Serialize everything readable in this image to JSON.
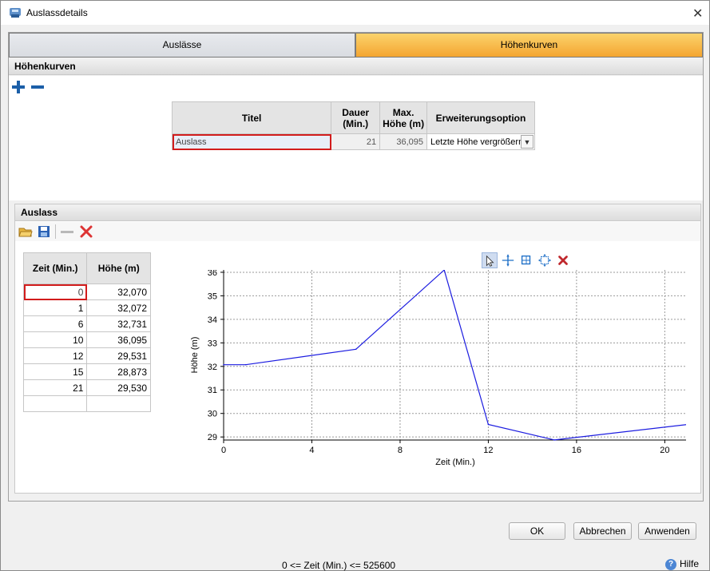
{
  "window": {
    "title": "Auslassdetails",
    "close_glyph": "✕"
  },
  "tabs": [
    {
      "label": "Auslässe"
    },
    {
      "label": "Höhenkurven"
    }
  ],
  "curves_section": {
    "title": "Höhenkurven",
    "columns": [
      "Titel",
      "Dauer (Min.)",
      "Max. Höhe (m)",
      "Erweiterungsoption"
    ],
    "col_lines": [
      [
        "Titel"
      ],
      [
        "Dauer",
        "(Min.)"
      ],
      [
        "Max.",
        "Höhe (m)"
      ],
      [
        "Erweiterungsoption"
      ]
    ],
    "row": {
      "title": "Auslass",
      "duration": "21",
      "max_height": "36,095",
      "option": "Letzte Höhe vergrößern"
    }
  },
  "outlet_section": {
    "title": "Auslass",
    "table": {
      "columns": [
        "Zeit (Min.)",
        "Höhe (m)"
      ],
      "rows": [
        [
          "0",
          "32,070"
        ],
        [
          "1",
          "32,072"
        ],
        [
          "6",
          "32,731"
        ],
        [
          "10",
          "36,095"
        ],
        [
          "12",
          "29,531"
        ],
        [
          "15",
          "28,873"
        ],
        [
          "21",
          "29,530"
        ],
        [
          "",
          ""
        ]
      ]
    }
  },
  "chart_data": {
    "type": "line",
    "xlabel": "Zeit (Min.)",
    "ylabel": "Höhe (m)",
    "xlim": [
      0,
      21
    ],
    "ylim": [
      28.87,
      36.1
    ],
    "xticks": [
      0,
      4,
      8,
      12,
      16,
      20
    ],
    "yticks": [
      29,
      30,
      31,
      32,
      33,
      34,
      35,
      36
    ],
    "grid": true,
    "color": "#1c1ce0",
    "x": [
      0,
      1,
      6,
      10,
      12,
      15,
      21
    ],
    "y": [
      32.07,
      32.072,
      32.731,
      36.095,
      29.531,
      28.873,
      29.53
    ]
  },
  "buttons": {
    "ok": "OK",
    "cancel": "Abbrechen",
    "apply": "Anwenden"
  },
  "status_text": "0 <= Zeit (Min.) <= 525600",
  "help_label": "Hilfe"
}
